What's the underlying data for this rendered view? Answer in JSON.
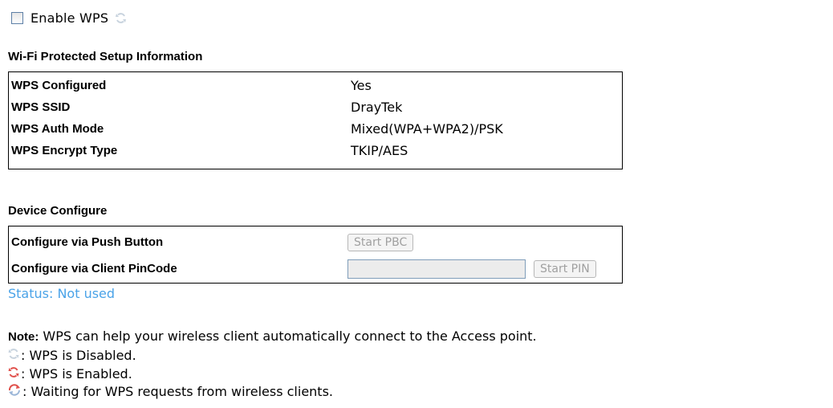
{
  "enable_wps": {
    "label": "Enable WPS",
    "checked": false,
    "state_icon": "wps-disabled-icon"
  },
  "info": {
    "title": "Wi-Fi Protected Setup Information",
    "rows": [
      {
        "key": "WPS Configured",
        "value": "Yes"
      },
      {
        "key": "WPS SSID",
        "value": "DrayTek"
      },
      {
        "key": "WPS Auth Mode",
        "value": "Mixed(WPA+WPA2)/PSK"
      },
      {
        "key": "WPS Encrypt Type",
        "value": "TKIP/AES"
      }
    ]
  },
  "device": {
    "title": "Device Configure",
    "push_button": {
      "label": "Configure via Push Button",
      "button": "Start PBC"
    },
    "pin": {
      "label": "Configure via Client PinCode",
      "input_value": "",
      "button": "Start PIN"
    }
  },
  "status": {
    "text": "Status: Not used",
    "color": "#4aa3e8"
  },
  "note": {
    "label": "Note:",
    "text": " WPS can help your wireless client automatically connect to the Access point."
  },
  "legend": [
    {
      "icon": "wps-disabled-icon",
      "text": ": WPS is Disabled."
    },
    {
      "icon": "wps-enabled-icon",
      "text": ": WPS is Enabled."
    },
    {
      "icon": "wps-waiting-icon",
      "text": ": Waiting for WPS requests from wireless clients."
    }
  ],
  "colors": {
    "disabled_icon": "#c8d3de",
    "enabled_icon": "#e0504b",
    "waiting_icon": "#e0504b",
    "waiting_icon_secondary": "#9bb6d8"
  }
}
